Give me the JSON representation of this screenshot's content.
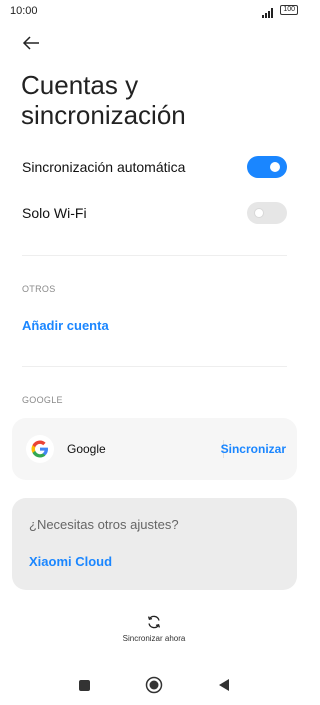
{
  "status": {
    "time": "10:00",
    "battery": "100"
  },
  "title": "Cuentas y sincronización",
  "settings": [
    {
      "label": "Sincronización automática",
      "state": "on"
    },
    {
      "label": "Solo Wi-Fi",
      "state": "off"
    }
  ],
  "sections": {
    "otros": {
      "header": "OTROS",
      "link": "Añadir cuenta"
    },
    "google": {
      "header": "GOOGLE",
      "account_name": "Google",
      "sync_label": "Sincronizar"
    }
  },
  "help": {
    "title": "¿Necesitas otros ajustes?",
    "link": "Xiaomi Cloud"
  },
  "sync_now": {
    "label": "Sincronizar ahora"
  },
  "nav": {
    "icons": [
      "square-icon",
      "home-icon",
      "back-triangle-icon"
    ]
  },
  "colors": {
    "accent": "#1a86ff",
    "toggle_off": "#e6e6e6",
    "card_bg": "#f6f6f6"
  }
}
